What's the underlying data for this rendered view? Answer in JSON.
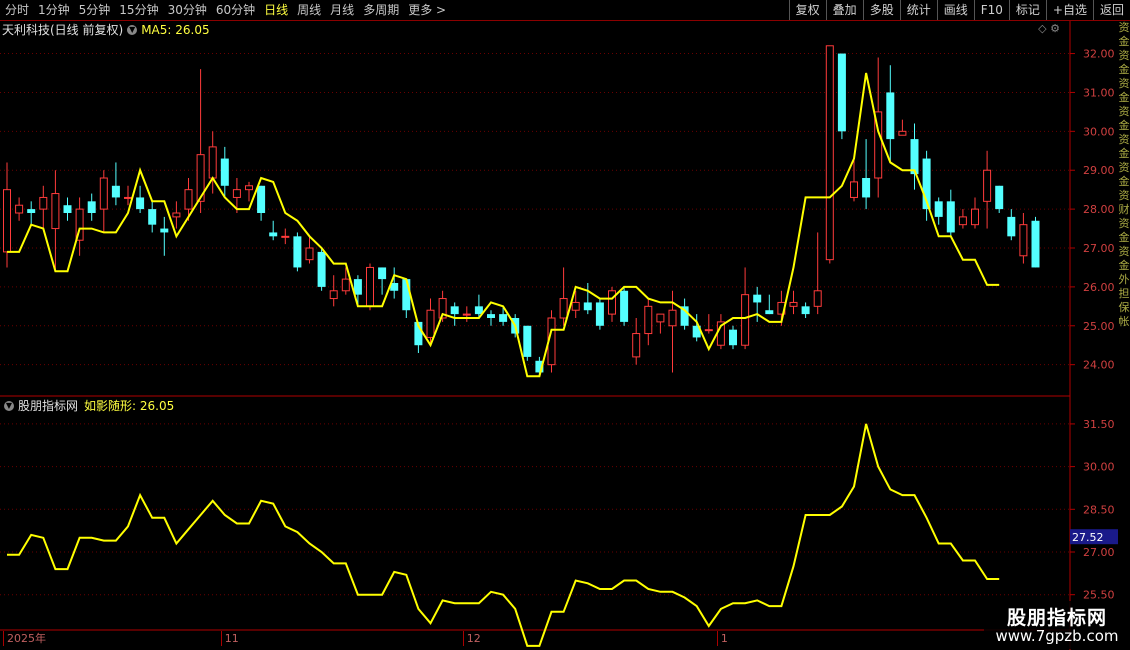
{
  "toolbar": {
    "tabs": [
      {
        "label": "分时",
        "active": false
      },
      {
        "label": "1分钟",
        "active": false
      },
      {
        "label": "5分钟",
        "active": false
      },
      {
        "label": "15分钟",
        "active": false
      },
      {
        "label": "30分钟",
        "active": false
      },
      {
        "label": "60分钟",
        "active": false
      },
      {
        "label": "日线",
        "active": true
      },
      {
        "label": "周线",
        "active": false
      },
      {
        "label": "月线",
        "active": false
      },
      {
        "label": "多周期",
        "active": false
      },
      {
        "label": "更多 >",
        "active": false
      }
    ],
    "buttons": [
      "复权",
      "叠加",
      "多股",
      "统计",
      "画线",
      "F10",
      "标记",
      "+自选",
      "返回"
    ]
  },
  "main_panel": {
    "stock_title": "天利科技(日线 前复权)",
    "ma_label": "MA5: 26.05",
    "y_labels": [
      "32.00",
      "31.00",
      "30.00",
      "29.00",
      "28.00",
      "27.00",
      "26.00",
      "25.00",
      "24.00"
    ]
  },
  "indicator_panel": {
    "name": "股朋指标网",
    "series_label": "如影随形: 26.05",
    "y_labels": [
      "31.50",
      "30.00",
      "28.50",
      "27.00",
      "25.50"
    ],
    "current_value": "27.52"
  },
  "date_axis": {
    "labels": [
      {
        "text": "2025年",
        "idx": 0
      },
      {
        "text": "11",
        "idx": 18
      },
      {
        "text": "12",
        "idx": 38
      },
      {
        "text": "1",
        "idx": 59
      }
    ]
  },
  "right_strip": {
    "chars": [
      "资",
      "金",
      "资",
      "金",
      "资",
      "金",
      "资",
      "金",
      "资",
      "金",
      "资",
      "金",
      "资",
      "财",
      "资",
      "金",
      "资",
      "金",
      "外",
      "担",
      "保",
      "帐"
    ]
  },
  "watermark": {
    "title": "股朋指标网",
    "url": "www.7gpzb.com"
  },
  "colors": {
    "up": "#ff3b3b",
    "down": "#54ffff",
    "ma": "#ffff00",
    "grid": "#8b0000",
    "axis_text": "#d04040"
  },
  "chart_data": {
    "type": "candlestick",
    "ma_name": "MA5",
    "ma_last": 26.05,
    "indicator_name": "如影随形",
    "indicator_last": 26.05,
    "main_ylim": [
      23.4,
      32.4
    ],
    "ind_ylim": [
      24.4,
      32.2
    ],
    "candles": [
      [
        26.9,
        28.5,
        26.5,
        29.2
      ],
      [
        27.9,
        28.1,
        27.7,
        28.3
      ],
      [
        28.0,
        27.9,
        27.6,
        28.2
      ],
      [
        28.0,
        28.3,
        27.5,
        28.6
      ],
      [
        27.5,
        28.4,
        26.4,
        29.0
      ],
      [
        28.1,
        27.9,
        27.7,
        28.3
      ],
      [
        27.2,
        28.0,
        26.8,
        28.3
      ],
      [
        28.2,
        27.9,
        27.7,
        28.4
      ],
      [
        28.0,
        28.8,
        27.4,
        29.0
      ],
      [
        28.6,
        28.3,
        28.1,
        29.2
      ],
      [
        28.3,
        28.3,
        28.1,
        28.6
      ],
      [
        28.3,
        28.0,
        27.9,
        28.6
      ],
      [
        28.0,
        27.6,
        27.4,
        28.2
      ],
      [
        27.5,
        27.4,
        26.8,
        27.8
      ],
      [
        27.8,
        27.9,
        27.5,
        28.2
      ],
      [
        28.0,
        28.5,
        27.7,
        28.8
      ],
      [
        28.2,
        29.4,
        27.9,
        31.6
      ],
      [
        28.8,
        29.6,
        28.4,
        30.0
      ],
      [
        29.3,
        28.6,
        28.3,
        29.6
      ],
      [
        28.3,
        28.5,
        27.9,
        28.8
      ],
      [
        28.5,
        28.6,
        28.2,
        28.7
      ],
      [
        28.6,
        27.9,
        27.7,
        28.6
      ],
      [
        27.4,
        27.3,
        27.2,
        27.7
      ],
      [
        27.3,
        27.3,
        27.1,
        27.5
      ],
      [
        27.3,
        26.5,
        26.4,
        27.4
      ],
      [
        26.7,
        27.0,
        26.6,
        27.3
      ],
      [
        26.9,
        26.0,
        25.9,
        27.0
      ],
      [
        25.7,
        25.9,
        25.5,
        26.3
      ],
      [
        25.9,
        26.2,
        25.8,
        26.5
      ],
      [
        26.2,
        25.8,
        25.5,
        26.3
      ],
      [
        25.5,
        26.5,
        25.4,
        26.6
      ],
      [
        26.5,
        26.2,
        25.8,
        26.5
      ],
      [
        26.1,
        25.9,
        25.7,
        26.5
      ],
      [
        26.2,
        25.4,
        25.2,
        26.2
      ],
      [
        25.1,
        24.5,
        24.3,
        25.1
      ],
      [
        24.7,
        25.4,
        24.5,
        25.7
      ],
      [
        25.2,
        25.7,
        25.1,
        25.9
      ],
      [
        25.5,
        25.3,
        25.0,
        25.6
      ],
      [
        25.3,
        25.3,
        25.1,
        25.5
      ],
      [
        25.5,
        25.3,
        25.2,
        25.8
      ],
      [
        25.3,
        25.2,
        25.0,
        25.4
      ],
      [
        25.3,
        25.1,
        25.0,
        25.5
      ],
      [
        25.2,
        24.8,
        24.7,
        25.3
      ],
      [
        25.0,
        24.2,
        24.1,
        25.0
      ],
      [
        24.1,
        23.8,
        23.7,
        24.2
      ],
      [
        24.0,
        25.2,
        23.8,
        25.4
      ],
      [
        25.2,
        25.7,
        25.0,
        26.5
      ],
      [
        25.4,
        25.6,
        25.2,
        25.9
      ],
      [
        25.6,
        25.4,
        25.3,
        26.1
      ],
      [
        25.6,
        25.0,
        24.9,
        25.7
      ],
      [
        25.3,
        25.9,
        25.1,
        26.0
      ],
      [
        25.9,
        25.1,
        25.0,
        26.0
      ],
      [
        24.2,
        24.8,
        24.0,
        25.2
      ],
      [
        24.8,
        25.5,
        24.5,
        25.7
      ],
      [
        25.1,
        25.3,
        24.8,
        25.3
      ],
      [
        25.0,
        25.4,
        23.8,
        25.9
      ],
      [
        25.5,
        25.0,
        24.9,
        25.7
      ],
      [
        25.0,
        24.7,
        24.6,
        25.3
      ],
      [
        24.9,
        24.9,
        24.8,
        25.3
      ],
      [
        24.5,
        25.1,
        24.4,
        25.3
      ],
      [
        24.9,
        24.5,
        24.4,
        25.0
      ],
      [
        24.5,
        25.8,
        24.4,
        26.5
      ],
      [
        25.8,
        25.6,
        25.1,
        26.0
      ],
      [
        25.4,
        25.3,
        25.3,
        25.8
      ],
      [
        25.3,
        25.6,
        25.0,
        25.9
      ],
      [
        25.5,
        25.6,
        25.3,
        25.9
      ],
      [
        25.5,
        25.3,
        25.2,
        25.6
      ],
      [
        25.5,
        25.9,
        25.3,
        27.4
      ],
      [
        26.7,
        32.2,
        26.6,
        32.2
      ],
      [
        32.0,
        30.0,
        29.8,
        32.0
      ],
      [
        28.3,
        28.7,
        28.2,
        29.3
      ],
      [
        28.8,
        28.3,
        28.0,
        29.8
      ],
      [
        28.8,
        30.5,
        28.3,
        31.9
      ],
      [
        31.0,
        29.8,
        29.2,
        31.7
      ],
      [
        29.9,
        30.0,
        29.9,
        30.3
      ],
      [
        29.8,
        28.9,
        28.5,
        30.2
      ],
      [
        29.3,
        28.0,
        27.7,
        29.5
      ],
      [
        28.2,
        27.8,
        27.6,
        28.3
      ],
      [
        28.2,
        27.4,
        27.3,
        28.5
      ],
      [
        27.6,
        27.8,
        27.5,
        28.0
      ],
      [
        27.6,
        28.0,
        27.5,
        28.3
      ],
      [
        28.2,
        29.0,
        27.5,
        29.5
      ],
      [
        28.6,
        28.0,
        27.9,
        28.6
      ],
      [
        27.8,
        27.3,
        27.2,
        28.0
      ],
      [
        26.8,
        27.6,
        26.6,
        27.9
      ],
      [
        27.7,
        26.5,
        26.5,
        27.8
      ]
    ],
    "ma5": [
      26.9,
      26.9,
      27.6,
      27.5,
      26.4,
      26.4,
      27.5,
      27.5,
      27.4,
      27.4,
      27.9,
      29.0,
      28.2,
      28.2,
      27.3,
      27.8,
      28.3,
      28.8,
      28.3,
      28.0,
      28.0,
      28.8,
      28.7,
      27.9,
      27.7,
      27.3,
      27.0,
      26.6,
      26.6,
      25.5,
      25.5,
      25.5,
      26.3,
      26.2,
      25.0,
      24.5,
      25.3,
      25.2,
      25.2,
      25.2,
      25.6,
      25.5,
      25.0,
      23.7,
      23.7,
      24.9,
      24.9,
      26.0,
      25.9,
      25.7,
      25.7,
      26.0,
      26.0,
      25.7,
      25.6,
      25.6,
      25.4,
      25.1,
      24.4,
      25.0,
      25.2,
      25.2,
      25.3,
      25.1,
      25.1,
      26.5,
      28.3,
      28.3,
      28.3,
      28.6,
      29.3,
      31.5,
      30.0,
      29.2,
      29.0,
      29.0,
      28.2,
      27.3,
      27.3,
      26.7,
      26.7,
      26.05,
      26.05
    ]
  }
}
